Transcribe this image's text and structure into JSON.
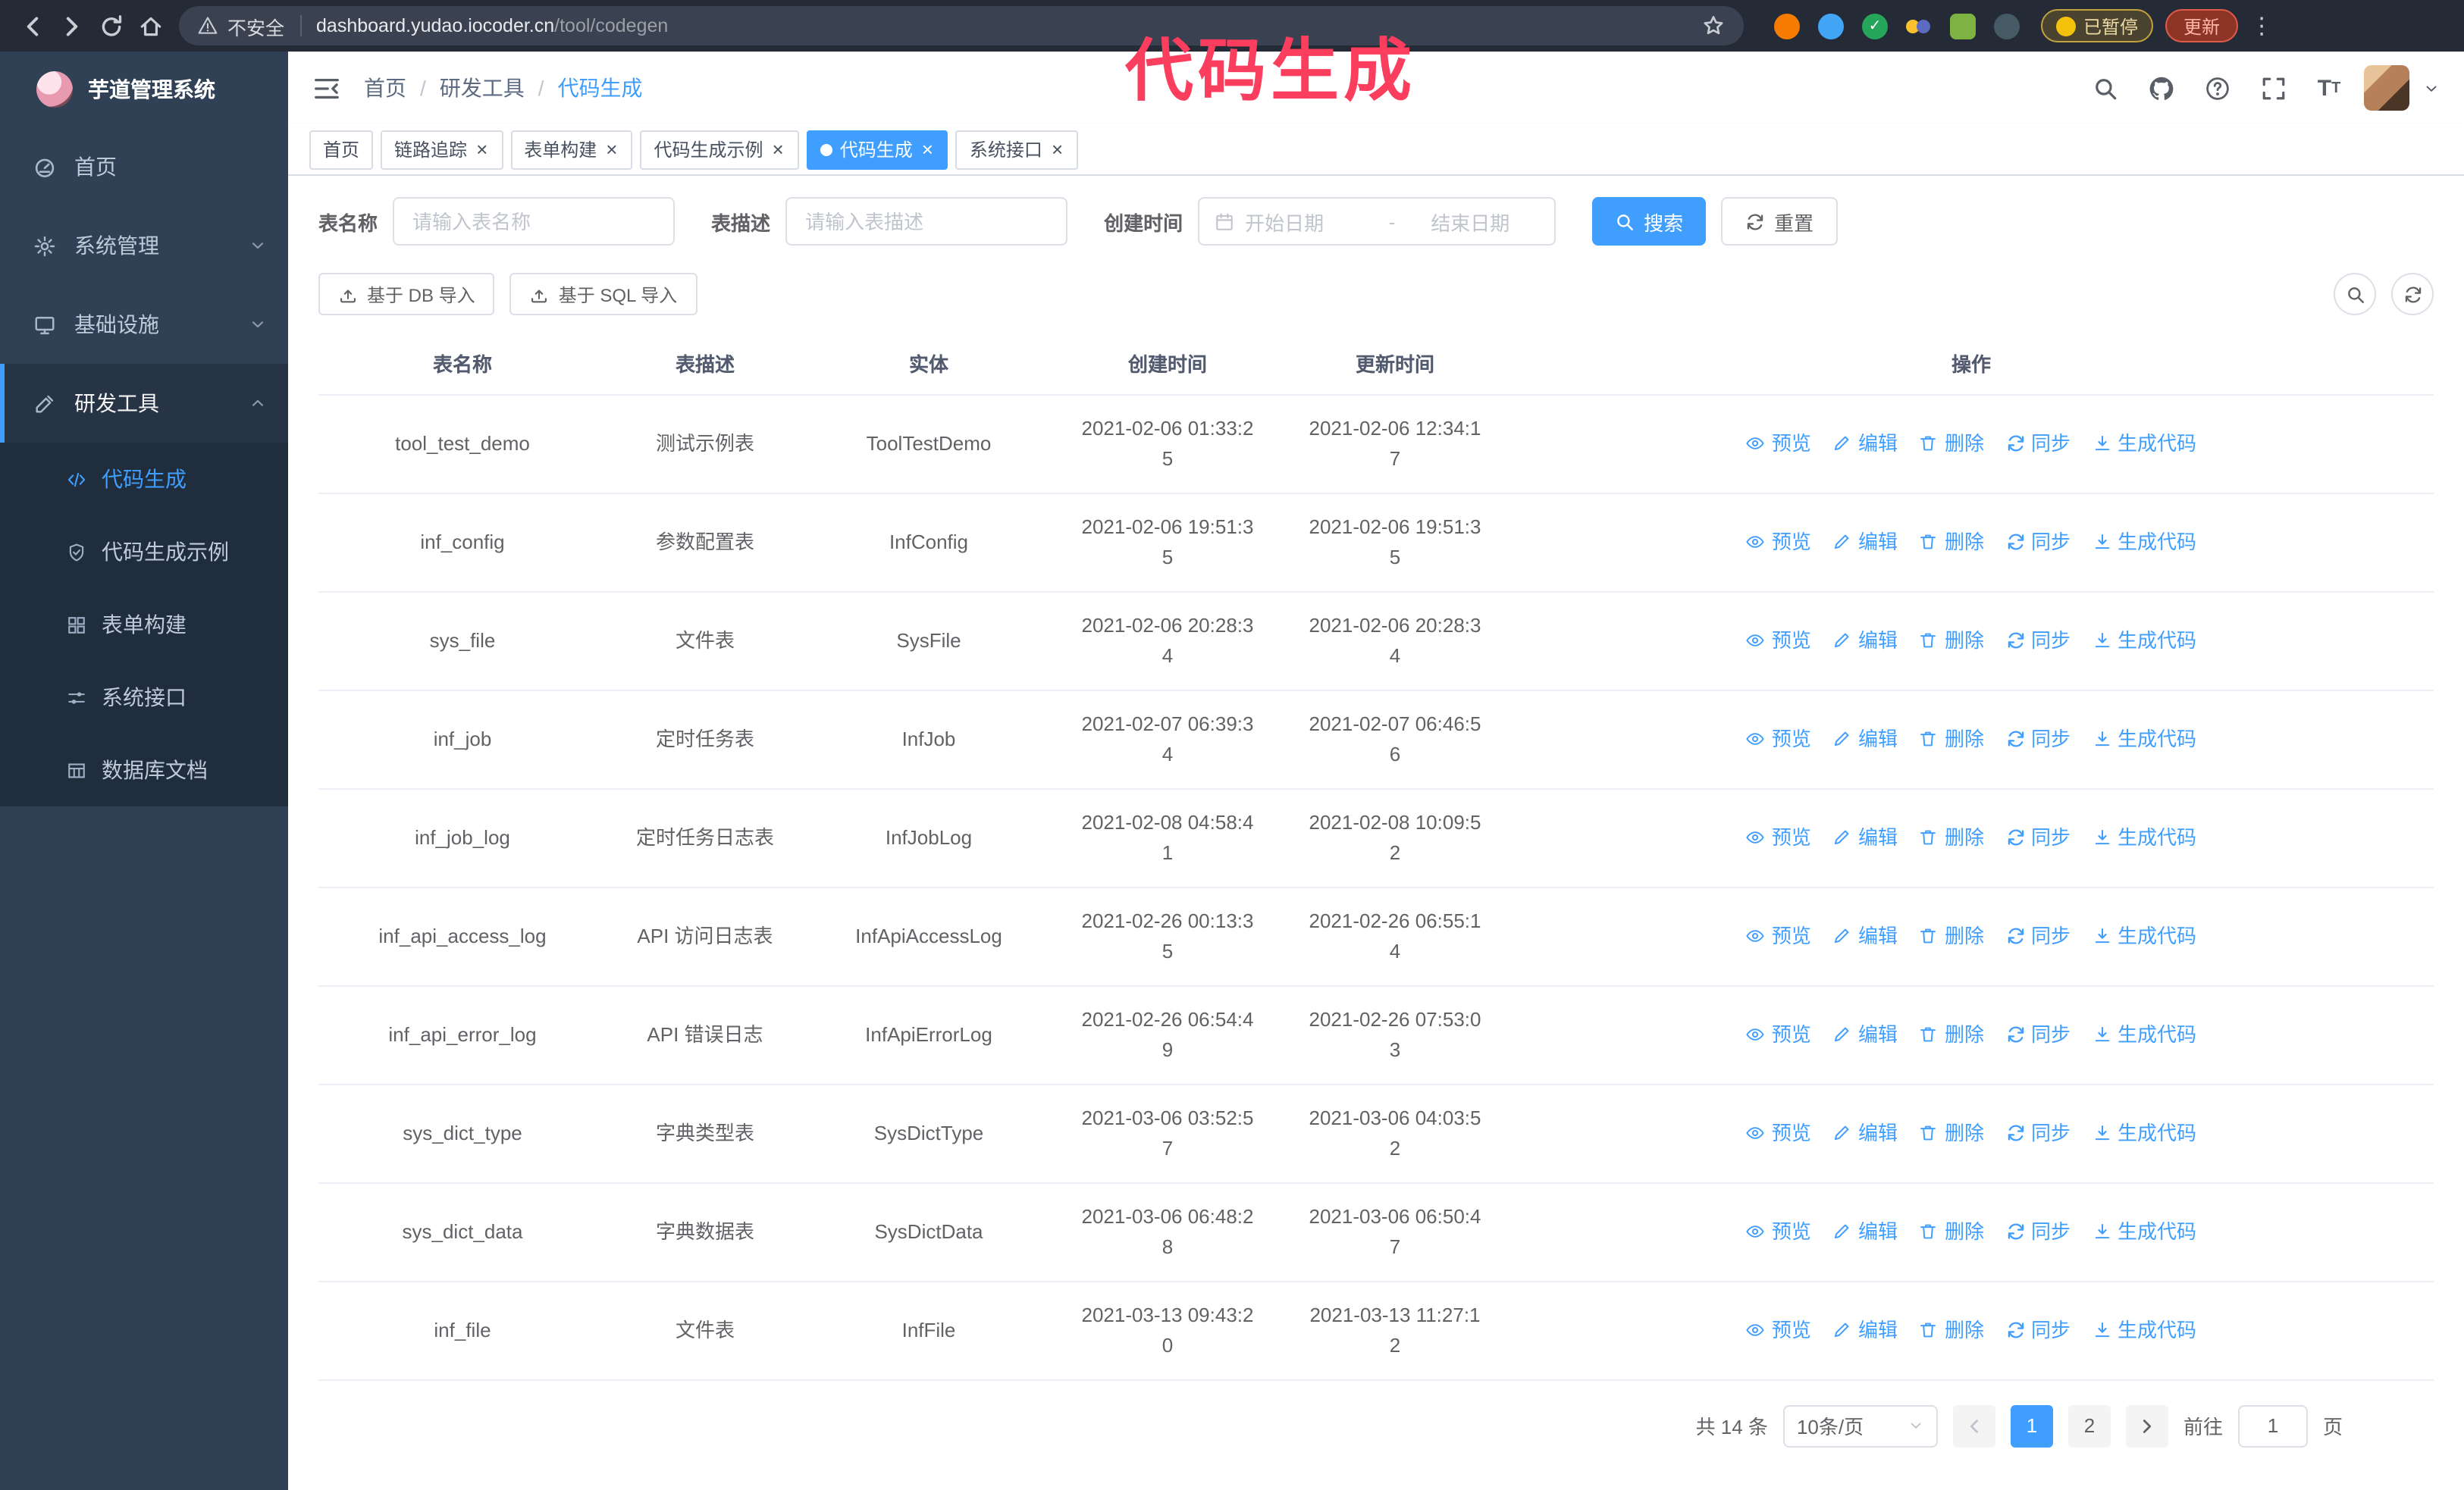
{
  "browser": {
    "security_label": "不安全",
    "url_host": "dashboard.yudao.iocoder.cn",
    "url_path": "/tool/codegen",
    "paused_badge": "已暂停",
    "update_button": "更新"
  },
  "annotation": {
    "text": "代码生成"
  },
  "sidebar": {
    "logo_title": "芋道管理系统",
    "items": [
      {
        "label": "首页",
        "icon": "dashboard-icon"
      },
      {
        "label": "系统管理",
        "icon": "gear-icon"
      },
      {
        "label": "基础设施",
        "icon": "monitor-icon"
      },
      {
        "label": "研发工具",
        "icon": "tools-icon"
      }
    ],
    "submenu": [
      {
        "label": "代码生成",
        "icon": "code-icon",
        "active": true
      },
      {
        "label": "代码生成示例",
        "icon": "shield-check-icon"
      },
      {
        "label": "表单构建",
        "icon": "grid-icon"
      },
      {
        "label": "系统接口",
        "icon": "sliders-icon"
      },
      {
        "label": "数据库文档",
        "icon": "table-icon"
      }
    ]
  },
  "header": {
    "breadcrumb": [
      "首页",
      "研发工具",
      "代码生成"
    ]
  },
  "tabs": [
    {
      "label": "首页",
      "active": false,
      "closable": false
    },
    {
      "label": "链路追踪",
      "active": false,
      "closable": true
    },
    {
      "label": "表单构建",
      "active": false,
      "closable": true
    },
    {
      "label": "代码生成示例",
      "active": false,
      "closable": true
    },
    {
      "label": "代码生成",
      "active": true,
      "closable": true
    },
    {
      "label": "系统接口",
      "active": false,
      "closable": true
    }
  ],
  "filter": {
    "name_label": "表名称",
    "name_placeholder": "请输入表名称",
    "desc_label": "表描述",
    "desc_placeholder": "请输入表描述",
    "time_label": "创建时间",
    "start_placeholder": "开始日期",
    "range_separator": "-",
    "end_placeholder": "结束日期",
    "search_button": "搜索",
    "reset_button": "重置"
  },
  "toolbar": {
    "import_db": "基于 DB 导入",
    "import_sql": "基于 SQL 导入"
  },
  "table": {
    "columns": [
      "表名称",
      "表描述",
      "实体",
      "创建时间",
      "更新时间",
      "操作"
    ],
    "ops": {
      "preview": "预览",
      "edit": "编辑",
      "delete": "删除",
      "sync": "同步",
      "generate": "生成代码"
    },
    "rows": [
      {
        "name": "tool_test_demo",
        "desc": "测试示例表",
        "entity": "ToolTestDemo",
        "created": "2021-02-06 01:33:25",
        "updated": "2021-02-06 12:34:17"
      },
      {
        "name": "inf_config",
        "desc": "参数配置表",
        "entity": "InfConfig",
        "created": "2021-02-06 19:51:35",
        "updated": "2021-02-06 19:51:35"
      },
      {
        "name": "sys_file",
        "desc": "文件表",
        "entity": "SysFile",
        "created": "2021-02-06 20:28:34",
        "updated": "2021-02-06 20:28:34"
      },
      {
        "name": "inf_job",
        "desc": "定时任务表",
        "entity": "InfJob",
        "created": "2021-02-07 06:39:34",
        "updated": "2021-02-07 06:46:56"
      },
      {
        "name": "inf_job_log",
        "desc": "定时任务日志表",
        "entity": "InfJobLog",
        "created": "2021-02-08 04:58:41",
        "updated": "2021-02-08 10:09:52"
      },
      {
        "name": "inf_api_access_log",
        "desc": "API 访问日志表",
        "entity": "InfApiAccessLog",
        "created": "2021-02-26 00:13:35",
        "updated": "2021-02-26 06:55:14"
      },
      {
        "name": "inf_api_error_log",
        "desc": "API 错误日志",
        "entity": "InfApiErrorLog",
        "created": "2021-02-26 06:54:49",
        "updated": "2021-02-26 07:53:03"
      },
      {
        "name": "sys_dict_type",
        "desc": "字典类型表",
        "entity": "SysDictType",
        "created": "2021-03-06 03:52:57",
        "updated": "2021-03-06 04:03:52"
      },
      {
        "name": "sys_dict_data",
        "desc": "字典数据表",
        "entity": "SysDictData",
        "created": "2021-03-06 06:48:28",
        "updated": "2021-03-06 06:50:47"
      },
      {
        "name": "inf_file",
        "desc": "文件表",
        "entity": "InfFile",
        "created": "2021-03-13 09:43:20",
        "updated": "2021-03-13 11:27:12"
      }
    ]
  },
  "pagination": {
    "total_text": "共 14 条",
    "page_size": "10条/页",
    "pages": [
      "1",
      "2"
    ],
    "active_page": "1",
    "goto_label": "前往",
    "goto_value": "1",
    "page_unit": "页"
  },
  "icons": {
    "preview": "eye-icon",
    "edit": "pencil-icon",
    "delete": "trash-icon",
    "sync": "refresh-icon",
    "generate": "download-icon",
    "search": "magnifier-icon",
    "reset": "refresh-icon",
    "import": "upload-icon"
  },
  "colors": {
    "primary": "#409eff",
    "annotation": "#fb3d5e",
    "sidebar_bg": "#304156",
    "submenu_bg": "#1f2d3d"
  }
}
